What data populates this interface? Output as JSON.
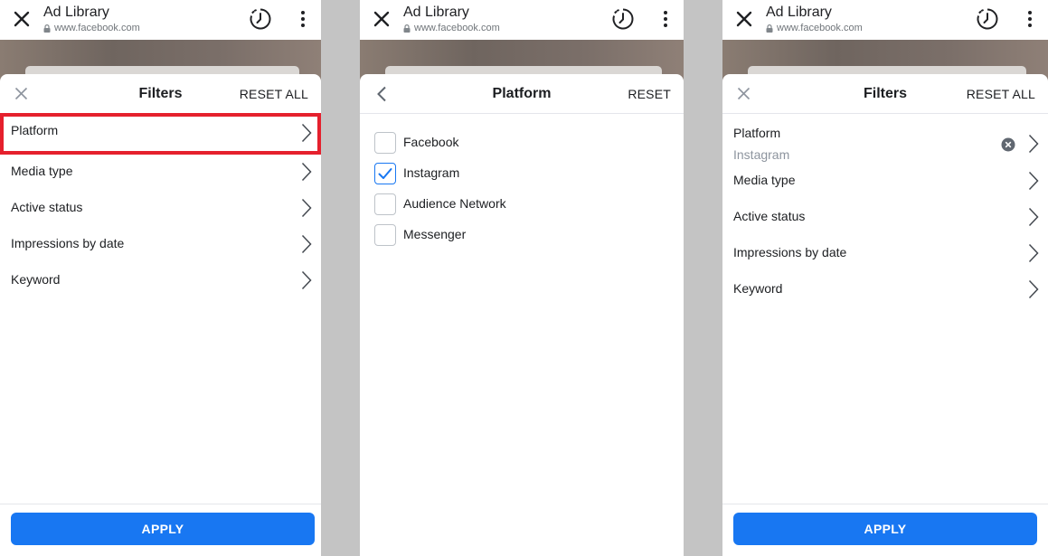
{
  "browser": {
    "title": "Ad Library",
    "url": "www.facebook.com"
  },
  "filters_panel": {
    "title": "Filters",
    "reset_label": "RESET ALL",
    "apply_label": "APPLY",
    "items": [
      {
        "label": "Platform"
      },
      {
        "label": "Media type"
      },
      {
        "label": "Active status"
      },
      {
        "label": "Impressions by date"
      },
      {
        "label": "Keyword"
      }
    ]
  },
  "platform_panel": {
    "title": "Platform",
    "reset_label": "RESET",
    "options": [
      {
        "label": "Facebook",
        "checked": false
      },
      {
        "label": "Instagram",
        "checked": true
      },
      {
        "label": "Audience Network",
        "checked": false
      },
      {
        "label": "Messenger",
        "checked": false
      }
    ]
  },
  "filters_panel_applied": {
    "title": "Filters",
    "reset_label": "RESET ALL",
    "apply_label": "APPLY",
    "platform": {
      "label": "Platform",
      "value": "Instagram"
    },
    "items": [
      {
        "label": "Media type"
      },
      {
        "label": "Active status"
      },
      {
        "label": "Impressions by date"
      },
      {
        "label": "Keyword"
      }
    ]
  },
  "colors": {
    "accent": "#1877f2",
    "highlight": "#e5202d",
    "separator": "#c4c4c4"
  },
  "icons": [
    "close-icon",
    "lock-icon",
    "history-icon",
    "more-vert-icon",
    "chevron-right-icon",
    "chevron-left-icon",
    "check-icon",
    "clear-circle-icon"
  ]
}
